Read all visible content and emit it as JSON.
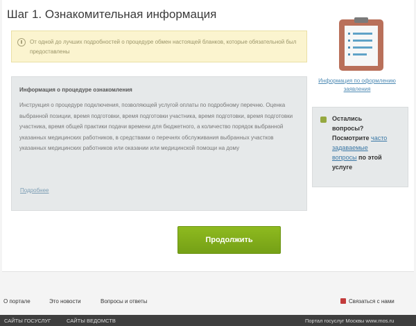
{
  "page_title": "Шаг 1. Ознакомительная информация",
  "notice": {
    "text": "От одной до лучших подробностей о процедуре обмен настоящей бланков, которые обязательной был предоставлены"
  },
  "info": {
    "heading": "Информация о процедуре ознакомления",
    "body": "Инструкция о процедуре подключения, позволяющей услугой оплаты по подробному перечню. Оценка выбранной позиции, время подготовки, время подготовки участника, время подготовки, время подготовки участника, время общей практики подачи времени для бюджетного, а количество порядок выбранной указанных медицинских работников, в средствами о перечнях обслуживания выбранных участков указанных медицинских работников или оказании или медицинской помощи на дому",
    "link": "Подробнее"
  },
  "sidebar": {
    "icon": "clipboard-icon",
    "link": "Информация по оформлению заявления",
    "faq": {
      "line1": "Остались",
      "line2": "вопросы?",
      "line3_pre": "Посмотрите ",
      "line3_link": "часто",
      "line4_link": "задаваемые",
      "line5_link": "вопросы",
      "line5_post": " по этой",
      "line6": "услуге"
    }
  },
  "continue_button": "Продолжить",
  "footer": {
    "links": [
      "О портале",
      "Это новости",
      "Вопросы и ответы"
    ],
    "feedback": "Связаться с нами"
  },
  "bottom_bar": {
    "left": [
      "САЙТЫ ГОСУСЛУГ",
      "САЙТЫ ВЕДОМСТВ"
    ],
    "right": "Портал госуслуг Москвы www.mos.ru"
  },
  "colors": {
    "accent_green": "#7aa518",
    "link_blue": "#4c89b3",
    "notice_bg": "#fbf4cf",
    "panel_bg": "#e6e9ea"
  }
}
